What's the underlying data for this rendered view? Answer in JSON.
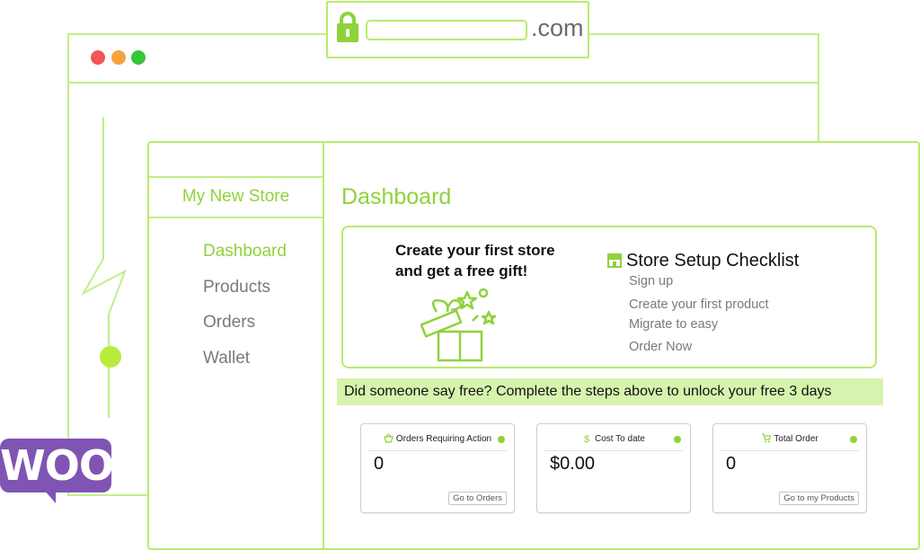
{
  "url_bar": {
    "tld": ".com"
  },
  "sidebar": {
    "store_name": "My New Store",
    "items": [
      {
        "label": "Dashboard",
        "active": true
      },
      {
        "label": "Products",
        "active": false
      },
      {
        "label": "Orders",
        "active": false
      },
      {
        "label": "Wallet",
        "active": false
      }
    ]
  },
  "main": {
    "title": "Dashboard",
    "promo": {
      "title": "Create your first store and get a free gift!"
    },
    "checklist": {
      "title": "Store Setup Checklist",
      "items": [
        "Sign up",
        "Create your first product",
        "Migrate to easy",
        "Order Now"
      ]
    },
    "banner": "Did someone say free? Complete the steps above to unlock your free 3 days",
    "stats": [
      {
        "title": "Orders Requiring Action",
        "value": "0",
        "link": "Go to Orders",
        "icon": "basket-icon"
      },
      {
        "title": "Cost To date",
        "value": "$0.00",
        "link": "",
        "icon": "dollar-icon"
      },
      {
        "title": "Total Order",
        "value": "0",
        "link": "Go to my Products",
        "icon": "cart-icon"
      }
    ]
  },
  "logo": {
    "text": "WOO"
  },
  "colors": {
    "accent": "#8fd23b",
    "border": "#b7ec6c",
    "banner": "#d6f4ae",
    "woo": "#7f54b3"
  }
}
